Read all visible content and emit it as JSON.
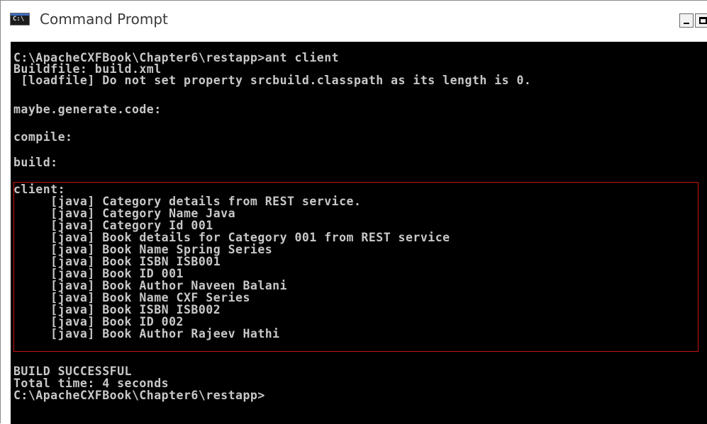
{
  "window": {
    "title": "Command Prompt",
    "icon": "C:\\",
    "controls": [
      "minimize",
      "maximize"
    ]
  },
  "console": {
    "lines": [
      "C:\\ApacheCXFBook\\Chapter6\\restapp>ant client",
      "Buildfile: build.xml",
      " [loadfile] Do not set property srcbuild.classpath as its length is 0.",
      "maybe.generate.code:",
      "compile:",
      "build:",
      "client:",
      "     [java] Category details from REST service.",
      "     [java] Category Name Java",
      "     [java] Category Id 001",
      "     [java] Book details for Category 001 from REST service",
      "     [java] Book Name Spring Series",
      "     [java] Book ISBN ISB001",
      "     [java] Book ID 001",
      "     [java] Book Author Naveen Balani",
      "     [java] Book Name CXF Series",
      "     [java] Book ISBN ISB002",
      "     [java] Book ID 002",
      "     [java] Book Author Rajeev Hathi",
      "BUILD SUCCESSFUL",
      "Total time: 4 seconds",
      "C:\\ApacheCXFBook\\Chapter6\\restapp>"
    ]
  },
  "colors": {
    "console_bg": "#000000",
    "console_text": "#c8c8c8",
    "highlight_border": "#cc1111"
  }
}
